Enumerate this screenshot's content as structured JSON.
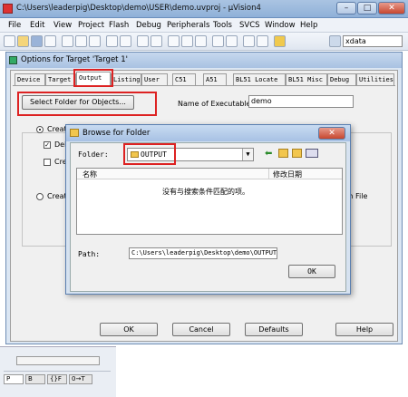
{
  "main_window": {
    "title": "C:\\Users\\leaderpig\\Desktop\\demo\\USER\\demo.uvproj - µVision4",
    "minimize_glyph": "–",
    "maximize_glyph": "□",
    "close_glyph": "✕"
  },
  "menu": [
    "File",
    "Edit",
    "View",
    "Project",
    "Flash",
    "Debug",
    "Peripherals",
    "Tools",
    "SVCS",
    "Window",
    "Help"
  ],
  "toolbar": {
    "search_value": "xdata"
  },
  "options_dialog": {
    "title": "Options for Target 'Target 1'",
    "tabs": [
      "Device",
      "Target",
      "Output",
      "Listing",
      "User",
      "C51",
      "A51",
      "BL51 Locate",
      "BL51 Misc",
      "Debug",
      "Utilities"
    ],
    "active_tab": "Output",
    "select_folder_button": "Select Folder for Objects...",
    "executable_label": "Name of Executable:",
    "executable_value": "demo",
    "create_label_1": "Create",
    "debug_label": "Debu",
    "create_label_2": "Crea",
    "create_label_3": "Create",
    "batch_file_tail": "ch File",
    "buttons": {
      "ok": "OK",
      "cancel": "Cancel",
      "defaults": "Defaults",
      "help": "Help"
    }
  },
  "browse_dialog": {
    "title": "Browse for Folder",
    "folder_label": "Folder:",
    "folder_value": "OUTPUT",
    "columns": [
      "名称",
      "修改日期"
    ],
    "empty_message": "没有与搜索条件匹配的项。",
    "path_label": "Path:",
    "path_value": "C:\\Users\\leaderpig\\Desktop\\demo\\OUTPUT\\",
    "ok_label": "OK"
  },
  "bottom_tabs": [
    "P",
    "B",
    "{}F",
    "0→T"
  ]
}
